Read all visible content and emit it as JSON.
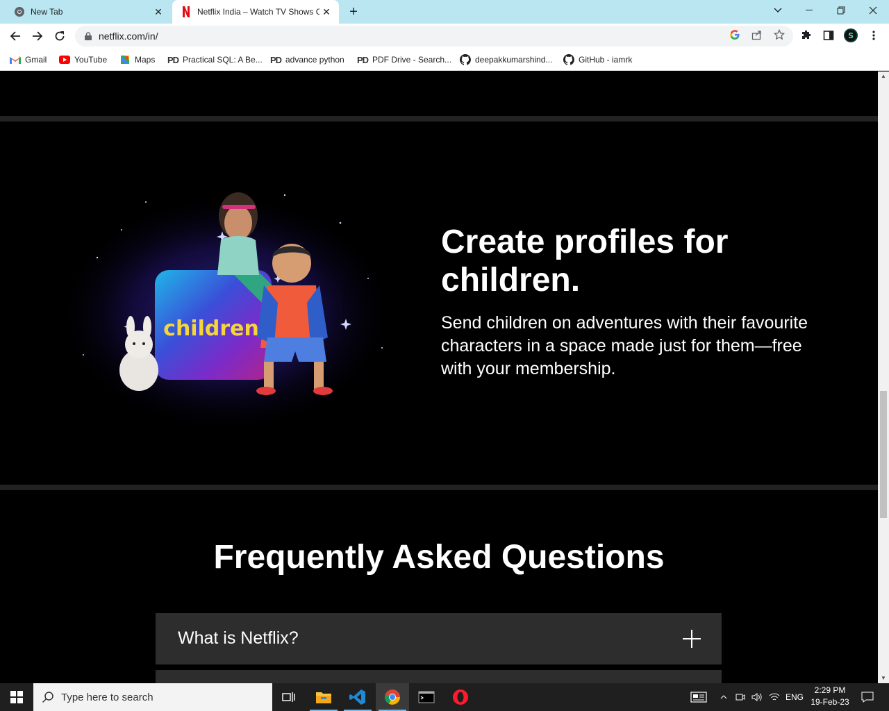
{
  "browser": {
    "tabs": [
      {
        "title": "New Tab",
        "active": false
      },
      {
        "title": "Netflix India – Watch TV Shows C",
        "active": true
      }
    ],
    "url": "netflix.com/in/",
    "bookmarks": [
      {
        "label": "Gmail",
        "icon": "gmail-icon"
      },
      {
        "label": "YouTube",
        "icon": "youtube-icon"
      },
      {
        "label": "Maps",
        "icon": "maps-icon"
      },
      {
        "label": "Practical SQL: A Be...",
        "icon": "pdf-drive-icon"
      },
      {
        "label": "advance python",
        "icon": "pdf-drive-icon"
      },
      {
        "label": "PDF Drive - Search...",
        "icon": "pdf-drive-icon"
      },
      {
        "label": "deepakkumarshind...",
        "icon": "github-icon"
      },
      {
        "label": "GitHub - iamrk",
        "icon": "github-icon"
      }
    ],
    "profile_initial": "S"
  },
  "page": {
    "feature": {
      "title": "Create profiles for children.",
      "subtitle": "Send children on adventures with their favourite characters in a space made just for them—free with your membership.",
      "art_label": "children"
    },
    "faq": {
      "title": "Frequently Asked Questions",
      "items": [
        {
          "question": "What is Netflix?"
        }
      ]
    }
  },
  "taskbar": {
    "search_placeholder": "Type here to search",
    "language": "ENG",
    "time": "2:29 PM",
    "date": "19-Feb-23"
  },
  "colors": {
    "netflix_red": "#e50914",
    "tabbar_bg": "#b9e6f0",
    "faq_bg": "#2d2d2d"
  }
}
